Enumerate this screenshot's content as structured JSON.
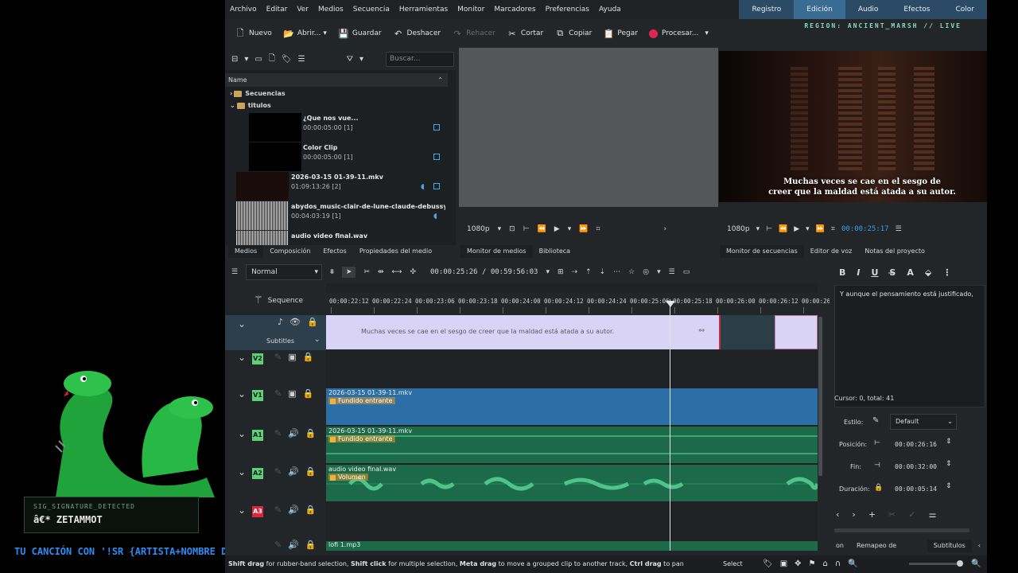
{
  "menu": [
    "Archivo",
    "Editar",
    "Ver",
    "Medios",
    "Secuencia",
    "Herramientas",
    "Monitor",
    "Marcadores",
    "Preferencias",
    "Ayuda"
  ],
  "workspaces": [
    "Registro",
    "Edición",
    "Audio",
    "Efectos",
    "Color"
  ],
  "region_text": "REGION: ANCIENT_MARSH // LIVE",
  "toolbar": {
    "new": "Nuevo",
    "open": "Abrir...",
    "save": "Guardar",
    "undo": "Deshacer",
    "redo": "Rehacer",
    "cut": "Cortar",
    "copy": "Copiar",
    "paste": "Pegar",
    "render": "Procesar..."
  },
  "bin": {
    "search_placeholder": "Buscar...",
    "header": "Name",
    "folders": [
      "Secuencias",
      "titulos"
    ],
    "clips": [
      {
        "name": "¿Que nos vue...",
        "duration": "00:00:05:00 [1]"
      },
      {
        "name": "Color Clip",
        "duration": "00:00:05:00 [1]"
      },
      {
        "name": "2026-03-15 01-39-11.mkv",
        "duration": "01:09:13:26 [2]"
      },
      {
        "name": "abydos_music-clair-de-lune-claude-debussy-mc",
        "duration": "00:04:03:19 [1]"
      },
      {
        "name": "audio video final.wav",
        "duration": ""
      }
    ],
    "tabs": [
      "Medios",
      "Composición",
      "Efectos",
      "Propiedades del medio"
    ]
  },
  "clip_monitor": {
    "resolution": "1080p",
    "tabs": [
      "Monitor de medios",
      "Biblioteca"
    ]
  },
  "seq_monitor": {
    "resolution": "1080p",
    "timecode": "00:00:25:17",
    "subtitle_line1": "Muchas veces se cae en el sesgo de",
    "subtitle_line2": "creer que la maldad está atada a su autor.",
    "tabs": [
      "Monitor de secuencias",
      "Editor de voz",
      "Notas del proyecto"
    ]
  },
  "timeline": {
    "mode": "Normal",
    "timecode": "00:00:25:26 / 00:59:56:03",
    "sequence_label": "Sequence",
    "ruler": [
      "00:00:22:12",
      "00:00:22:24",
      "00:00:23:06",
      "00:00:23:18",
      "00:00:24:00",
      "00:00:24:12",
      "00:00:24:24",
      "00:00:25:06",
      "00:00:25:18",
      "00:00:26:00",
      "00:00:26:12",
      "00:00:26"
    ],
    "subtitles_label": "Subtitles",
    "subtitle_text": "Muchas veces se cae en el sesgo de creer que la maldad está atada a su autor.",
    "tracks": [
      "V2",
      "V1",
      "A1",
      "A2",
      "A3"
    ],
    "v1_title": "2026-03-15 01-39-11.mkv",
    "v1_fx": "Fundido entrante",
    "a1_title": "2026-03-15 01-39-11.mkv",
    "a1_fx": "Fundido entrante",
    "a2_title": "audio video final.wav",
    "a2_fx": "Volumen",
    "a4_title": "lofi 1.mp3"
  },
  "sub_editor": {
    "text": "Y aunque el pensamiento está justificado,",
    "cursor": "Cursor: 0, total: 41",
    "style_label": "Estilo:",
    "style_value": "Default",
    "position_label": "Posición:",
    "position_value": "00:00:26:16",
    "end_label": "Fin:",
    "end_value": "00:00:32:00",
    "duration_label": "Duración:",
    "duration_value": "00:00:05:14",
    "tabs": [
      "Remapeo de tiempo",
      "Subtítulos"
    ],
    "tab_partial": "on"
  },
  "status": {
    "hint_b1": "Shift drag",
    "hint_t1": " for rubber-band selection, ",
    "hint_b2": "Shift click",
    "hint_t2": " for multiple selection, ",
    "hint_b3": "Meta drag",
    "hint_t3": " to move a grouped clip to another track, ",
    "hint_b4": "Ctrl drag",
    "hint_t4": " to pan",
    "select": "Select"
  },
  "overlay": {
    "sig_small": "SIG_SIGNATURE_DETECTED",
    "sig_name": "â€* ZETAMMOT",
    "ticker": "TU CANCIÓN CON '!SR {ARTISTA+NOMBRE DE LA CANCIÓN}'"
  },
  "colors": {
    "accent": "#3a6b92",
    "video_clip": "#2c6ea6",
    "audio_clip": "#1d6a4a",
    "subtitle_clip": "#d9d4f5",
    "record": "#e0264e",
    "track_a3": "#e0263e",
    "track_green": "#5fd07a"
  }
}
